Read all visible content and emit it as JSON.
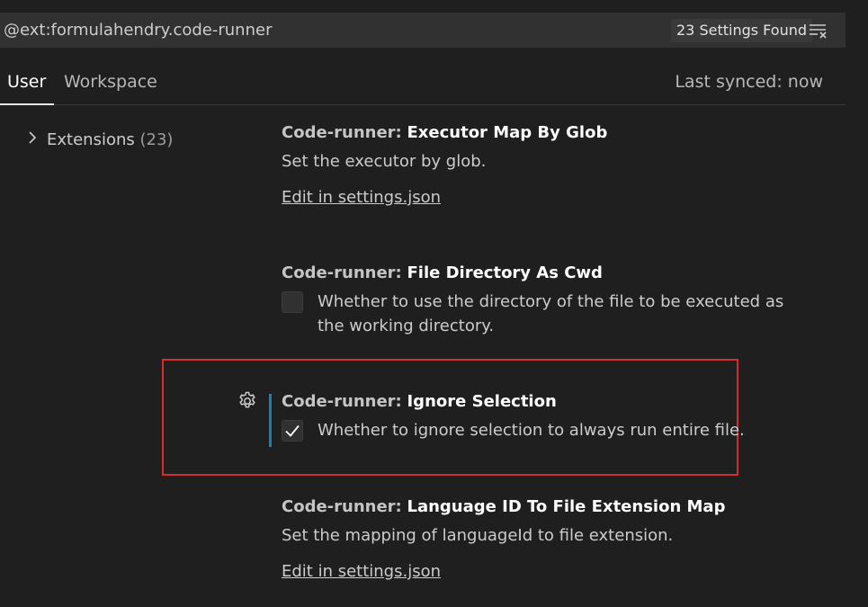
{
  "search": {
    "query": "@ext:formulahendry.code-runner",
    "count_label": "23 Settings Found",
    "clear_icon": "clear-filter-icon"
  },
  "tabs": {
    "user_label": "User",
    "workspace_label": "Workspace",
    "active": "User",
    "last_synced": "Last synced: now"
  },
  "toc": {
    "items": [
      {
        "label": "Extensions",
        "count": "(23)",
        "icon": "chevron-right-icon"
      }
    ]
  },
  "settings": [
    {
      "category": "Code-runner:",
      "name": "Executor Map By Glob",
      "description": "Set the executor by glob.",
      "link": "Edit in settings.json"
    },
    {
      "category": "Code-runner:",
      "name": "File Directory As Cwd",
      "description": "Whether to use the directory of the file to be executed as the working directory.",
      "checked": false
    },
    {
      "category": "Code-runner:",
      "name": "Ignore Selection",
      "description": "Whether to ignore selection to always run entire file.",
      "checked": true,
      "modified": true
    },
    {
      "category": "Code-runner:",
      "name": "Language ID To File Extension Map",
      "description": "Set the mapping of languageId to file extension.",
      "link": "Edit in settings.json"
    }
  ],
  "colors": {
    "background": "#1f1f1f",
    "highlight_border": "#d32f2f",
    "modified_indicator": "#1b80b2"
  }
}
